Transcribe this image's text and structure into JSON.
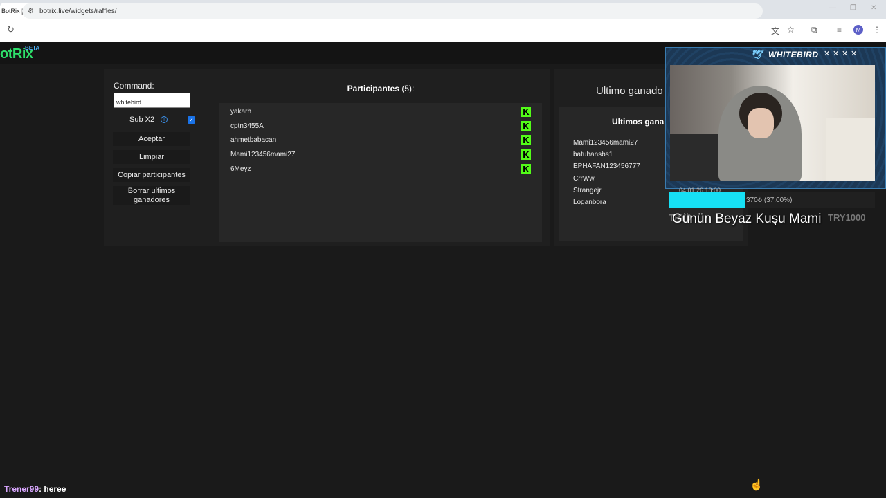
{
  "browser": {
    "tab_title": "BotRix | Sorteos",
    "tab_close": "×",
    "new_tab": "+",
    "url": "botrix.live/widgets/raffles/",
    "profile_initial": "M"
  },
  "app": {
    "logo": "otRix",
    "badge": "BETA"
  },
  "controls": {
    "command_label": "Command:",
    "command_value": "whitebird",
    "sub_label": "Sub X2",
    "sub_checked": true,
    "accept": "Aceptar",
    "clear": "Limpiar",
    "copy": "Copiar participantes",
    "delete_line1": "Borrar ultimos",
    "delete_line2": "ganadores"
  },
  "participants": {
    "title": "Participantes",
    "count": "(5):",
    "items": [
      "yakarh",
      "cptn3455A",
      "ahmetbabacan",
      "Mami123456mami27",
      "6Meyz"
    ]
  },
  "winners": {
    "last_winner_label": "Ultimo ganado",
    "list_title": "Ultimos gana",
    "items": [
      "Mami123456mami27",
      "batuhansbs1",
      "EPHAFAN123456777",
      "CrrWw",
      "Strangejr",
      "Loganbora"
    ]
  },
  "stream_overlay": {
    "brand": "WHITEBIRD",
    "goal_date": "04.01.26 18:00",
    "goal_progress_text": "370₺ (37.00%)",
    "goal_progress": 0.37,
    "goal_left": "TRY0",
    "goal_right": "TRY1000",
    "goal_title": "Günün Beyaz Kuşu Mami"
  },
  "chat": {
    "user": "Trener99",
    "message": ": heree"
  },
  "colors": {
    "kick_green": "#53fc18",
    "logo_green": "#2ee06b",
    "goal_cyan": "#17e0f5"
  }
}
